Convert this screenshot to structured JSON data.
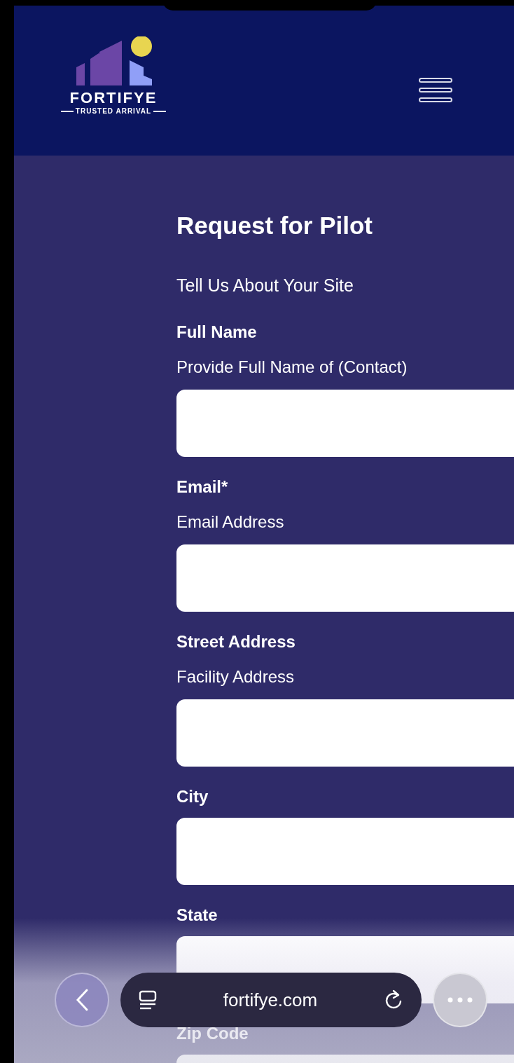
{
  "header": {
    "logo": {
      "name": "FORTIFYE",
      "tagline": "TRUSTED ARRIVAL"
    }
  },
  "form": {
    "title": "Request for Pilot",
    "subtitle": "Tell Us About Your Site",
    "fields": [
      {
        "label": "Full Name",
        "help": "Provide Full Name of (Contact)"
      },
      {
        "label": "Email*",
        "help": "Email Address"
      },
      {
        "label": "Street Address",
        "help": "Facility Address"
      },
      {
        "label": "City"
      },
      {
        "label": "State"
      },
      {
        "label": "Zip Code"
      }
    ]
  },
  "browser_bar": {
    "url": "fortifye.com"
  }
}
